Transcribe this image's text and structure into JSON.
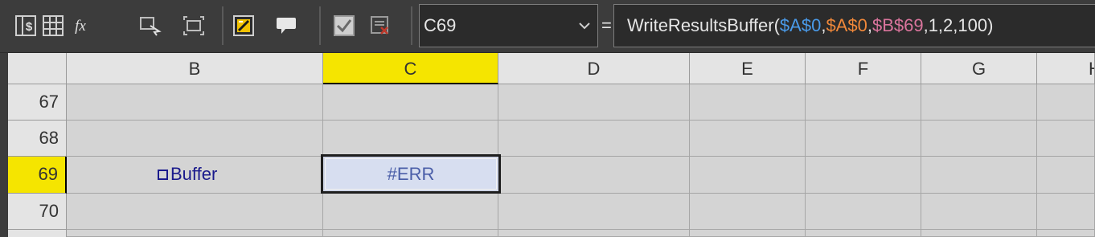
{
  "toolbar": {
    "icons": [
      "currency-format-icon",
      "table-grid-icon",
      "function-icon",
      "select-cell-icon",
      "expand-range-icon",
      "note-edit-icon",
      "comment-icon",
      "checkbox-icon",
      "delete-check-icon"
    ]
  },
  "name_box": {
    "value": "C69"
  },
  "equals_label": "=",
  "formula_bar": {
    "parts": [
      {
        "text": "WriteResultsBuffer(",
        "color": "#e6e6e6"
      },
      {
        "text": "$A$0",
        "color": "#4a9ae8"
      },
      {
        "text": ",",
        "color": "#e6e6e6"
      },
      {
        "text": "$A$0",
        "color": "#f0883a"
      },
      {
        "text": ",",
        "color": "#e6e6e6"
      },
      {
        "text": "$B$69",
        "color": "#d9749c"
      },
      {
        "text": ",1,2,100)",
        "color": "#e6e6e6"
      }
    ]
  },
  "grid": {
    "columns": [
      "B",
      "C",
      "D",
      "E",
      "F",
      "G",
      "H"
    ],
    "selected_column": "C",
    "rows": [
      "67",
      "68",
      "69",
      "70"
    ],
    "selected_row": "69",
    "cells": {
      "B69": "Buffer",
      "C69": "#ERR"
    }
  },
  "colors": {
    "header_highlight": "#f5e500",
    "cell_text": "#1a1a8c",
    "error_text": "#4a5ea8"
  }
}
